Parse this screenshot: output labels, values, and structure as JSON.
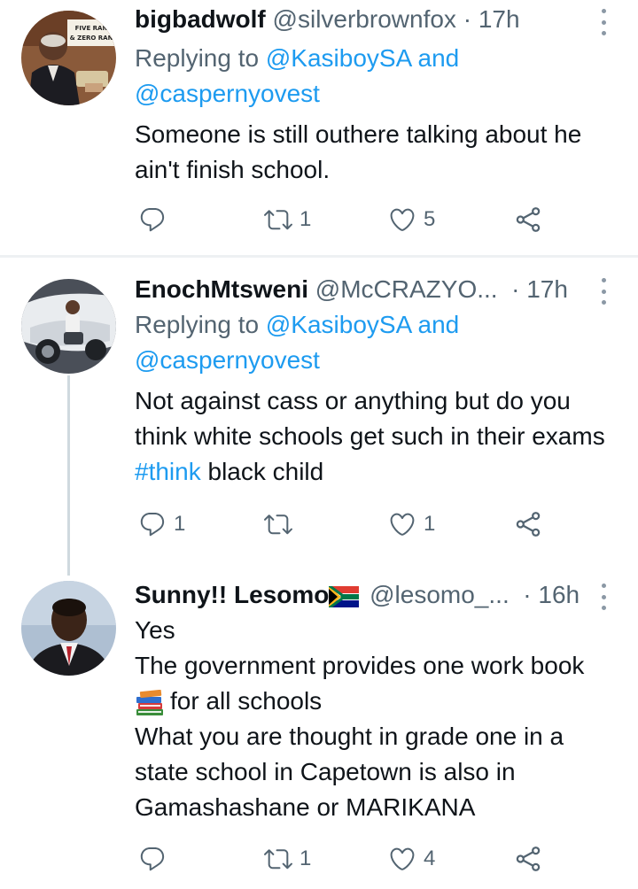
{
  "tweets": [
    {
      "name": "bigbadwolf",
      "handle": "@silverbrownfox",
      "time": "17h",
      "replying_prefix": "Replying to",
      "replying_to_1": "@KasiboySA",
      "replying_and": "and",
      "replying_to_2": "@caspernyovest",
      "text": "Someone is still outhere talking about he ain't finish school.",
      "avatar_sign_line1": "FIVE RAN",
      "avatar_sign_line2": "& ZERO RAN",
      "replies": "",
      "retweets": "1",
      "likes": "5"
    },
    {
      "name": "EnochMtsweni",
      "handle": "@McCRAZYO...",
      "time": "17h",
      "replying_prefix": "Replying to",
      "replying_to_1": "@KasiboySA",
      "replying_and": "and",
      "replying_to_2": "@caspernyovest",
      "text_before": "Not against cass or anything but do you think white schools get such in their exams ",
      "hashtag": "#think",
      "text_after": " black child",
      "replies": "1",
      "retweets": "",
      "likes": "1"
    },
    {
      "name": "Sunny!! Lesomo",
      "handle": "@lesomo_...",
      "time": "16h",
      "line1": "Yes",
      "line2": "The government provides one work book",
      "line3": "for all schools",
      "line4": "What you are thought in grade one in a state school in Capetown is also in Gamashashane or MARIKANA",
      "replies": "",
      "retweets": "1",
      "likes": "4"
    }
  ],
  "colors": {
    "text": "#0f1419",
    "secondary": "#536471",
    "link": "#1d9bf0",
    "divider": "#eef1f3",
    "thread_line": "#cfd9de"
  },
  "icons": [
    "reply-icon",
    "retweet-icon",
    "like-icon",
    "share-icon",
    "more-icon",
    "flag-emoji-icon",
    "books-emoji-icon"
  ]
}
